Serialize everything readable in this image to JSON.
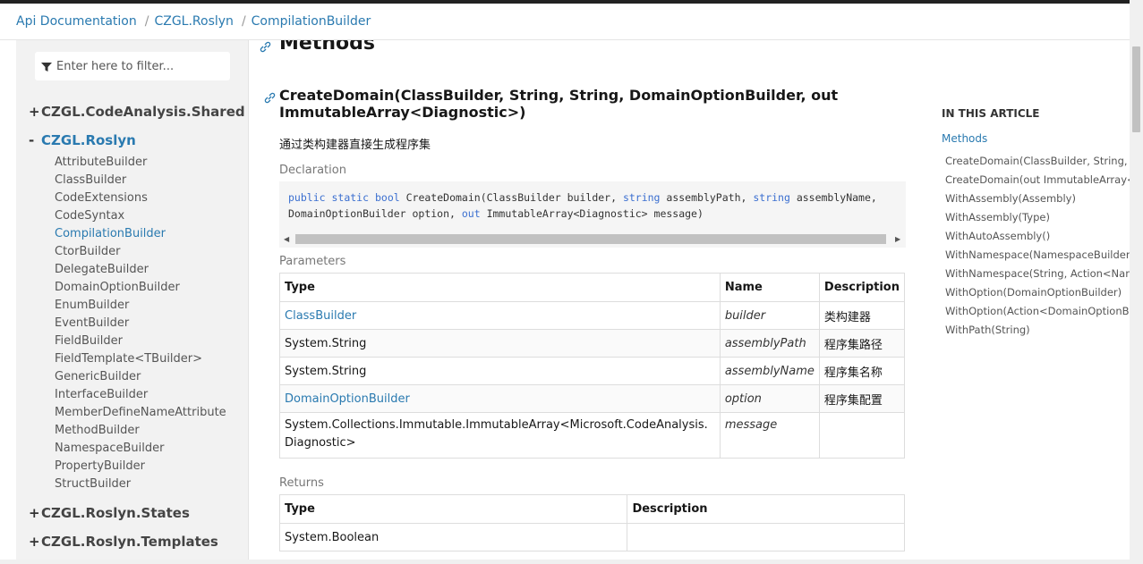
{
  "breadcrumb": [
    "Api Documentation",
    "CZGL.Roslyn",
    "CompilationBuilder"
  ],
  "sidebar": {
    "filter_placeholder": "Enter here to filter...",
    "namespaces": [
      {
        "toggle": "+",
        "label": "CZGL.CodeAnalysis.Shared"
      },
      {
        "toggle": "-",
        "label": "CZGL.Roslyn"
      },
      {
        "toggle": "+",
        "label": "CZGL.Roslyn.States"
      },
      {
        "toggle": "+",
        "label": "CZGL.Roslyn.Templates"
      }
    ],
    "classes": [
      "AttributeBuilder",
      "ClassBuilder",
      "CodeExtensions",
      "CodeSyntax",
      "CompilationBuilder",
      "CtorBuilder",
      "DelegateBuilder",
      "DomainOptionBuilder",
      "EnumBuilder",
      "EventBuilder",
      "FieldBuilder",
      "FieldTemplate<TBuilder>",
      "GenericBuilder",
      "InterfaceBuilder",
      "MemberDefineNameAttribute",
      "MethodBuilder",
      "NamespaceBuilder",
      "PropertyBuilder",
      "StructBuilder"
    ],
    "active_class": "CompilationBuilder"
  },
  "main": {
    "section_title": "Methods",
    "method_title": "CreateDomain(ClassBuilder, String, String, DomainOptionBuilder, out ImmutableArray<Diagnostic>)",
    "summary": "通过类构建器直接生成程序集",
    "declaration_label": "Declaration",
    "code": {
      "kw_public": "public",
      "kw_static": "static",
      "kw_bool": "bool",
      "name_open": "CreateDomain(ClassBuilder builder, ",
      "kw_string1": "string",
      "mid1": " assemblyPath, ",
      "kw_string2": "string",
      "mid2": " assemblyName,",
      "line2_a": "DomainOptionBuilder option, ",
      "kw_out": "out",
      "line2_b": " ImmutableArray<Diagnostic> message)"
    },
    "parameters_label": "Parameters",
    "param_headers": [
      "Type",
      "Name",
      "Description"
    ],
    "params": [
      {
        "type": "ClassBuilder",
        "name": "builder",
        "desc": "类构建器"
      },
      {
        "type": "System.String",
        "name": "assemblyPath",
        "desc": "程序集路径"
      },
      {
        "type": "System.String",
        "name": "assemblyName",
        "desc": "程序集名称"
      },
      {
        "type": "DomainOptionBuilder",
        "name": "option",
        "desc": "程序集配置"
      },
      {
        "type": "System.Collections.Immutable.ImmutableArray<Microsoft.CodeAnalysis.Diagnostic>",
        "name": "message",
        "desc": ""
      }
    ],
    "returns_label": "Returns",
    "returns_headers": [
      "Type",
      "Description"
    ],
    "returns": [
      {
        "type": "System.Boolean",
        "desc": ""
      }
    ]
  },
  "rail": {
    "title": "IN THIS ARTICLE",
    "methods_link": "Methods",
    "items": [
      "CreateDomain(ClassBuilder, String, String,",
      "CreateDomain(out ImmutableArray<Di",
      "WithAssembly(Assembly)",
      "WithAssembly(Type)",
      "WithAutoAssembly()",
      "WithNamespace(NamespaceBuilder)",
      "WithNamespace(String, Action<Names",
      "WithOption(DomainOptionBuilder)",
      "WithOption(Action<DomainOptionBuil",
      "WithPath(String)"
    ]
  },
  "colors": {
    "link": "#2a7ab0",
    "keyword": "#3b6fd0"
  }
}
